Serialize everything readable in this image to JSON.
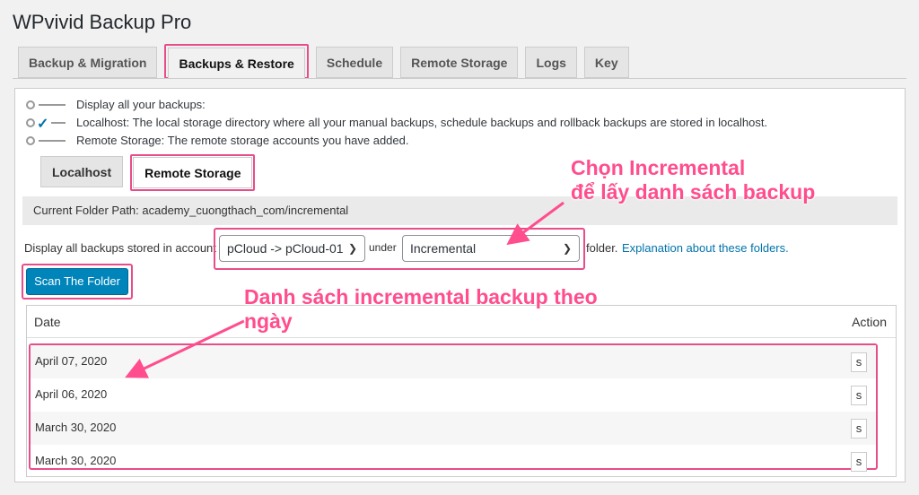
{
  "app": {
    "title": "WPvivid Backup Pro"
  },
  "tabs": [
    "Backup & Migration",
    "Backups & Restore",
    "Schedule",
    "Remote Storage",
    "Logs",
    "Key"
  ],
  "legend": [
    "Display all your backups:",
    "Localhost: The local storage directory where all your manual backups, schedule backups and rollback backups are stored in localhost.",
    "Remote Storage: The remote storage accounts you have added."
  ],
  "subtabs": [
    "Localhost",
    "Remote Storage"
  ],
  "folder_path": "Current Folder Path: academy_cuongthach_com/incremental",
  "display": {
    "prefix": "Display all backups stored in account",
    "account_value": "pCloud -> pCloud-01",
    "under": "under",
    "folder_value": "Incremental",
    "suffix": "folder.",
    "link": "Explanation about these folders."
  },
  "scan_button": "Scan The Folder",
  "table": {
    "col_date": "Date",
    "col_action": "Action",
    "rows": [
      {
        "date": "April 07, 2020",
        "action": "s"
      },
      {
        "date": "April 06, 2020",
        "action": "s"
      },
      {
        "date": "March 30, 2020",
        "action": "s"
      },
      {
        "date": "March 30, 2020",
        "action": "s"
      }
    ]
  },
  "annotations": {
    "top_line1": "Chọn Incremental",
    "top_line2": "để lấy danh sách backup",
    "bottom_line1": "Danh sách incremental backup theo",
    "bottom_line2": "ngày"
  },
  "colors": {
    "highlight": "#e84d8a",
    "annotation_text": "#ff4d8d",
    "primary": "#0085ba",
    "link": "#0073aa"
  }
}
